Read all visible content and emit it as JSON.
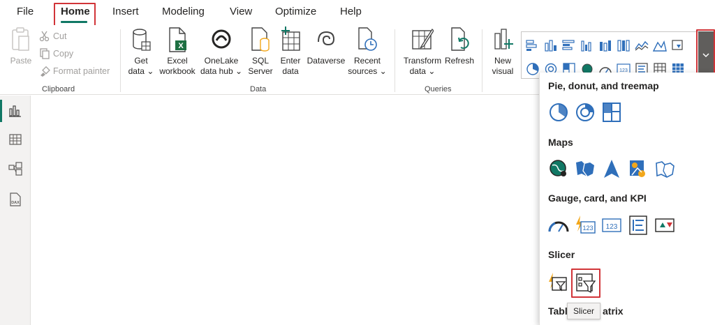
{
  "menu": {
    "items": [
      "File",
      "Home",
      "Insert",
      "Modeling",
      "View",
      "Optimize",
      "Help"
    ],
    "active": "Home"
  },
  "clipboard": {
    "paste": "Paste",
    "cut": "Cut",
    "copy": "Copy",
    "format_painter": "Format painter",
    "group": "Clipboard"
  },
  "data_group": {
    "get_data_1": "Get",
    "get_data_2": "data",
    "excel_1": "Excel",
    "excel_2": "workbook",
    "onelake_1": "OneLake",
    "onelake_2": "data hub",
    "sql_1": "SQL",
    "sql_2": "Server",
    "enter_1": "Enter",
    "enter_2": "data",
    "dataverse": "Dataverse",
    "recent_1": "Recent",
    "recent_2": "sources",
    "group": "Data"
  },
  "queries": {
    "transform_1": "Transform",
    "transform_2": "data",
    "refresh": "Refresh",
    "group": "Queries"
  },
  "insert": {
    "new_visual_1": "New",
    "new_visual_2": "visual"
  },
  "flyout": {
    "sections": {
      "pie": "Pie, donut, and treemap",
      "maps": "Maps",
      "gauge": "Gauge, card, and KPI",
      "slicer": "Slicer",
      "table_part1": "Tabl",
      "table_part2": "atrix"
    },
    "tooltip": "Slicer"
  },
  "colors": {
    "accent": "#117865",
    "highlight": "#d13438",
    "blue": "#2f6fba",
    "orange": "#f2a71b"
  }
}
